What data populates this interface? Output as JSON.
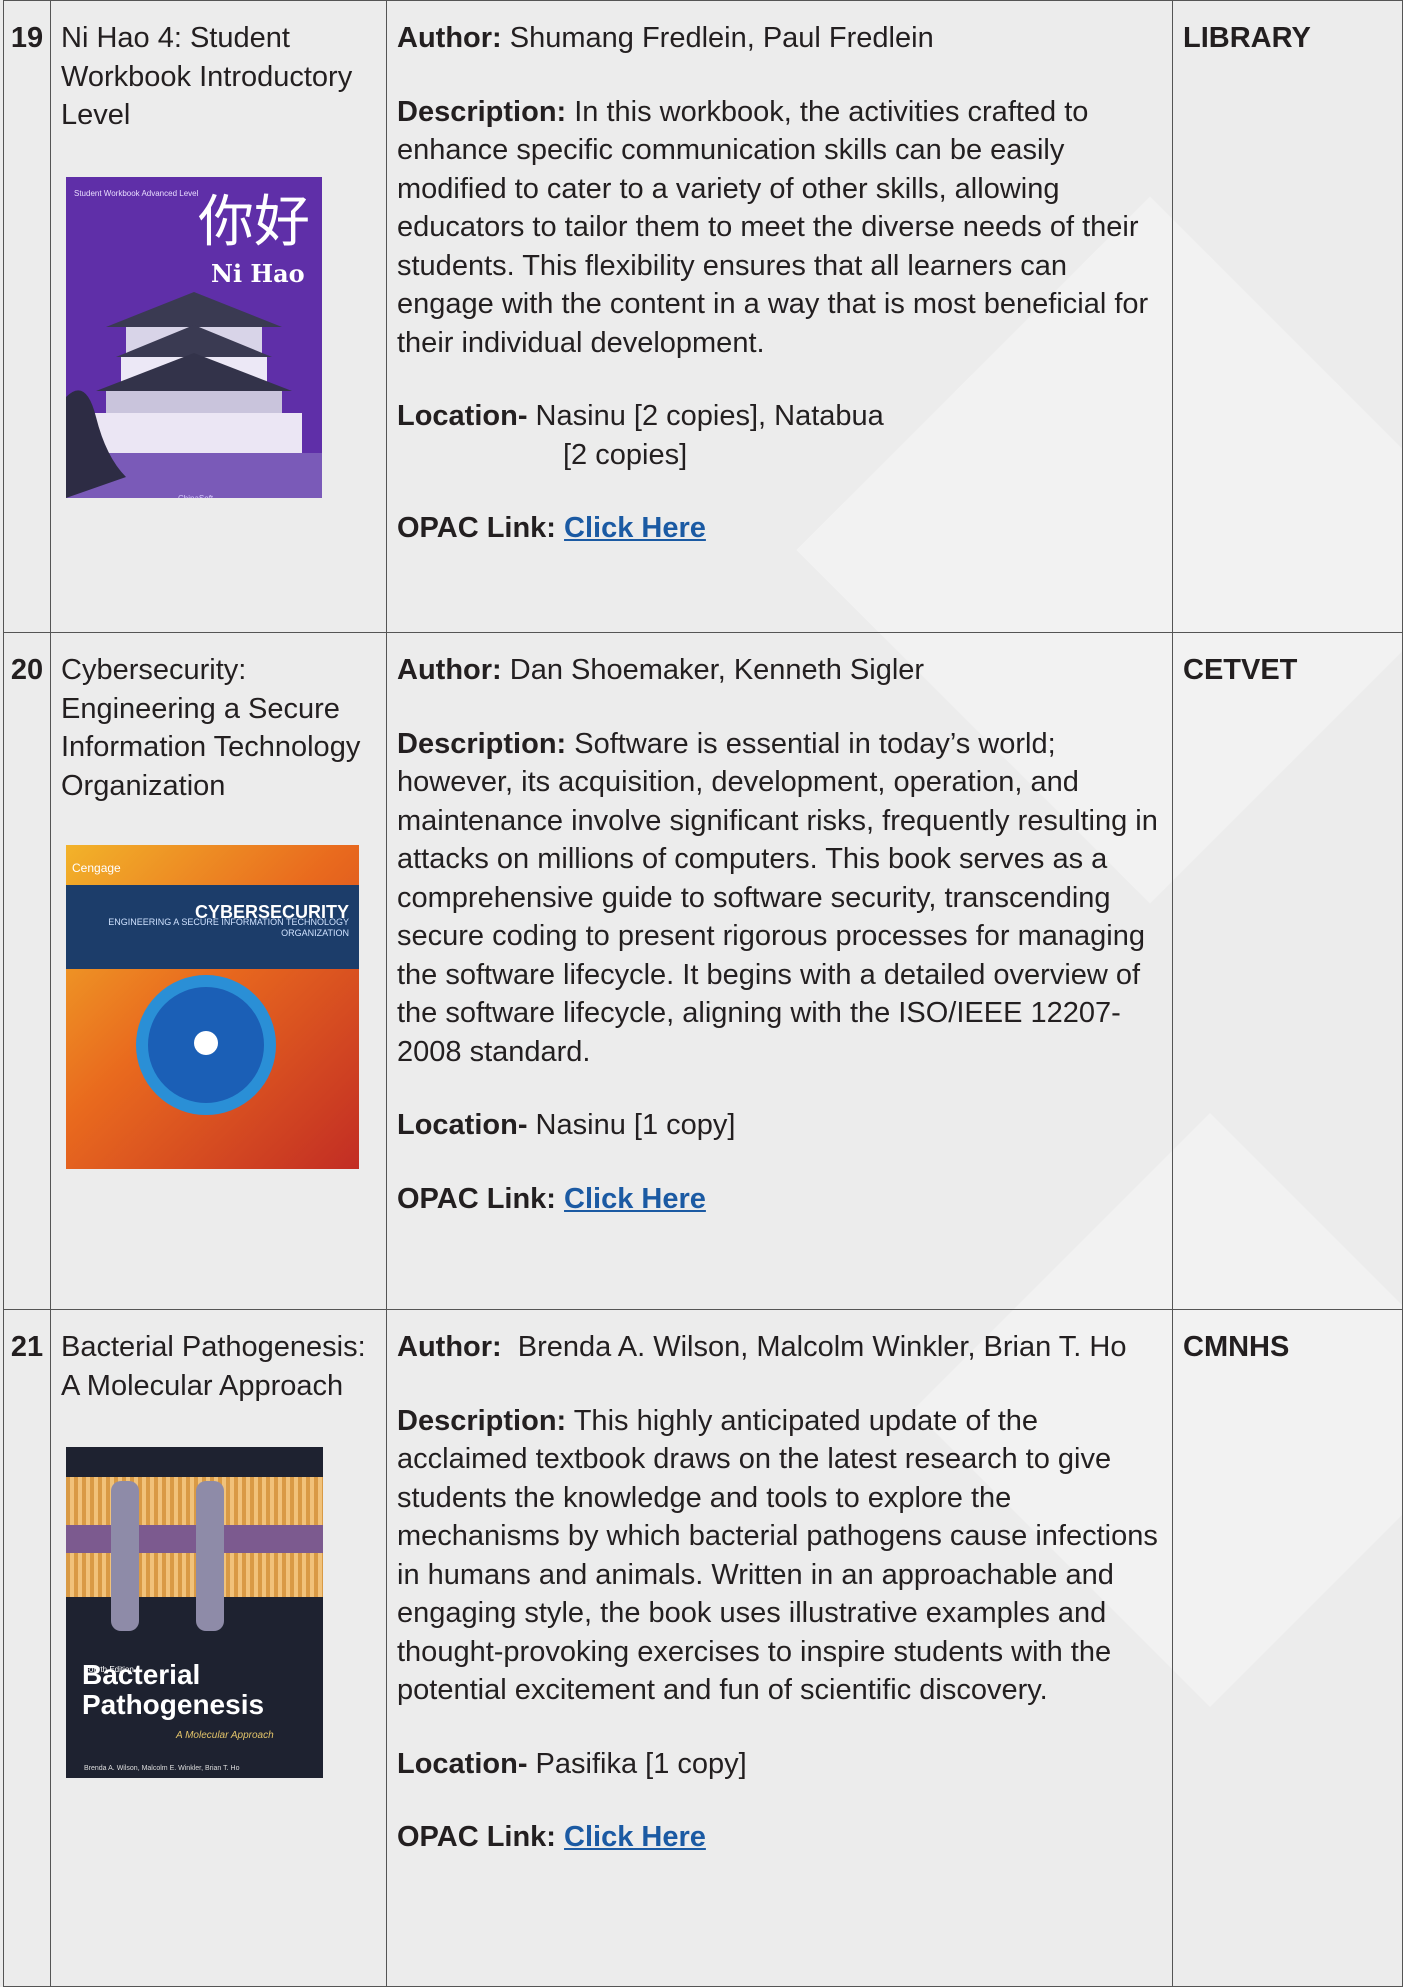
{
  "entries": [
    {
      "number": "19",
      "title": "Ni Hao 4: Student Workbook Introductory Level",
      "cover": {
        "chinese": "你好",
        "title": "Ni Hao",
        "subtitle": "Student Workbook Advanced Level",
        "publisher": "ChinaSoft"
      },
      "author_label": "Author:",
      "author": " Shumang Fredlein, Paul Fredlein",
      "description_label": "Description:",
      "description": " In this workbook, the activities crafted to enhance specific communication skills can be easily modified to cater to a variety of other skills, allowing educators to tailor them to meet the diverse needs of their students. This flexibility ensures that all learners can engage with the content in a way that is most beneficial for their individual development.",
      "location_label": "Location-",
      "location": " Nasinu [2 copies], Natabua",
      "location_cont": "[2 copies]",
      "opac_label": "OPAC Link:",
      "opac_link": "Click Here",
      "department": "LIBRARY"
    },
    {
      "number": "20",
      "title": "Cybersecurity: Engineering a Secure Information Technology Organization",
      "cover": {
        "publisher": "Cengage",
        "title": "CYBERSECURITY",
        "subtitle": "ENGINEERING A SECURE INFORMATION TECHNOLOGY ORGANIZATION"
      },
      "author_label": "Author:",
      "author": " Dan Shoemaker, Kenneth Sigler",
      "description_label": "Description:",
      "description": " Software is essential in today’s world; however, its acquisition, development, operation, and maintenance involve significant risks, frequently resulting in attacks on millions of computers. This book serves as a comprehensive guide to software security, transcending secure coding to present rigorous processes for managing the software lifecycle. It begins with a detailed overview of the software lifecycle, aligning with the ISO/IEEE 12207-2008 standard.",
      "location_label": "Location-",
      "location": " Nasinu [1 copy]",
      "opac_label": "OPAC Link:",
      "opac_link": "Click Here",
      "department": "CETVET"
    },
    {
      "number": "21",
      "title": "Bacterial Pathogenesis: A Molecular Approach",
      "cover": {
        "edition": "Fourth Edition",
        "title": "Bacterial Pathogenesis",
        "subtitle": "A Molecular Approach",
        "authors": "Brenda A. Wilson, Malcolm E. Winkler, Brian T. Ho"
      },
      "author_label": "Author:",
      "author": "  Brenda A. Wilson, Malcolm Winkler, Brian T. Ho",
      "description_label": "Description:",
      "description": " This highly anticipated update of the acclaimed textbook draws on the latest research to give students the knowledge and tools to explore the mechanisms by which bacterial pathogens cause infections in humans and animals. Written in an approachable and engaging style, the book uses illustrative examples and thought-provoking exercises to inspire students with the potential excitement and fun of scientific discovery.",
      "location_label": "Location-",
      "location": " Pasifika [1 copy]",
      "opac_label": "OPAC Link:",
      "opac_link": "Click Here",
      "department": "CMNHS"
    }
  ]
}
